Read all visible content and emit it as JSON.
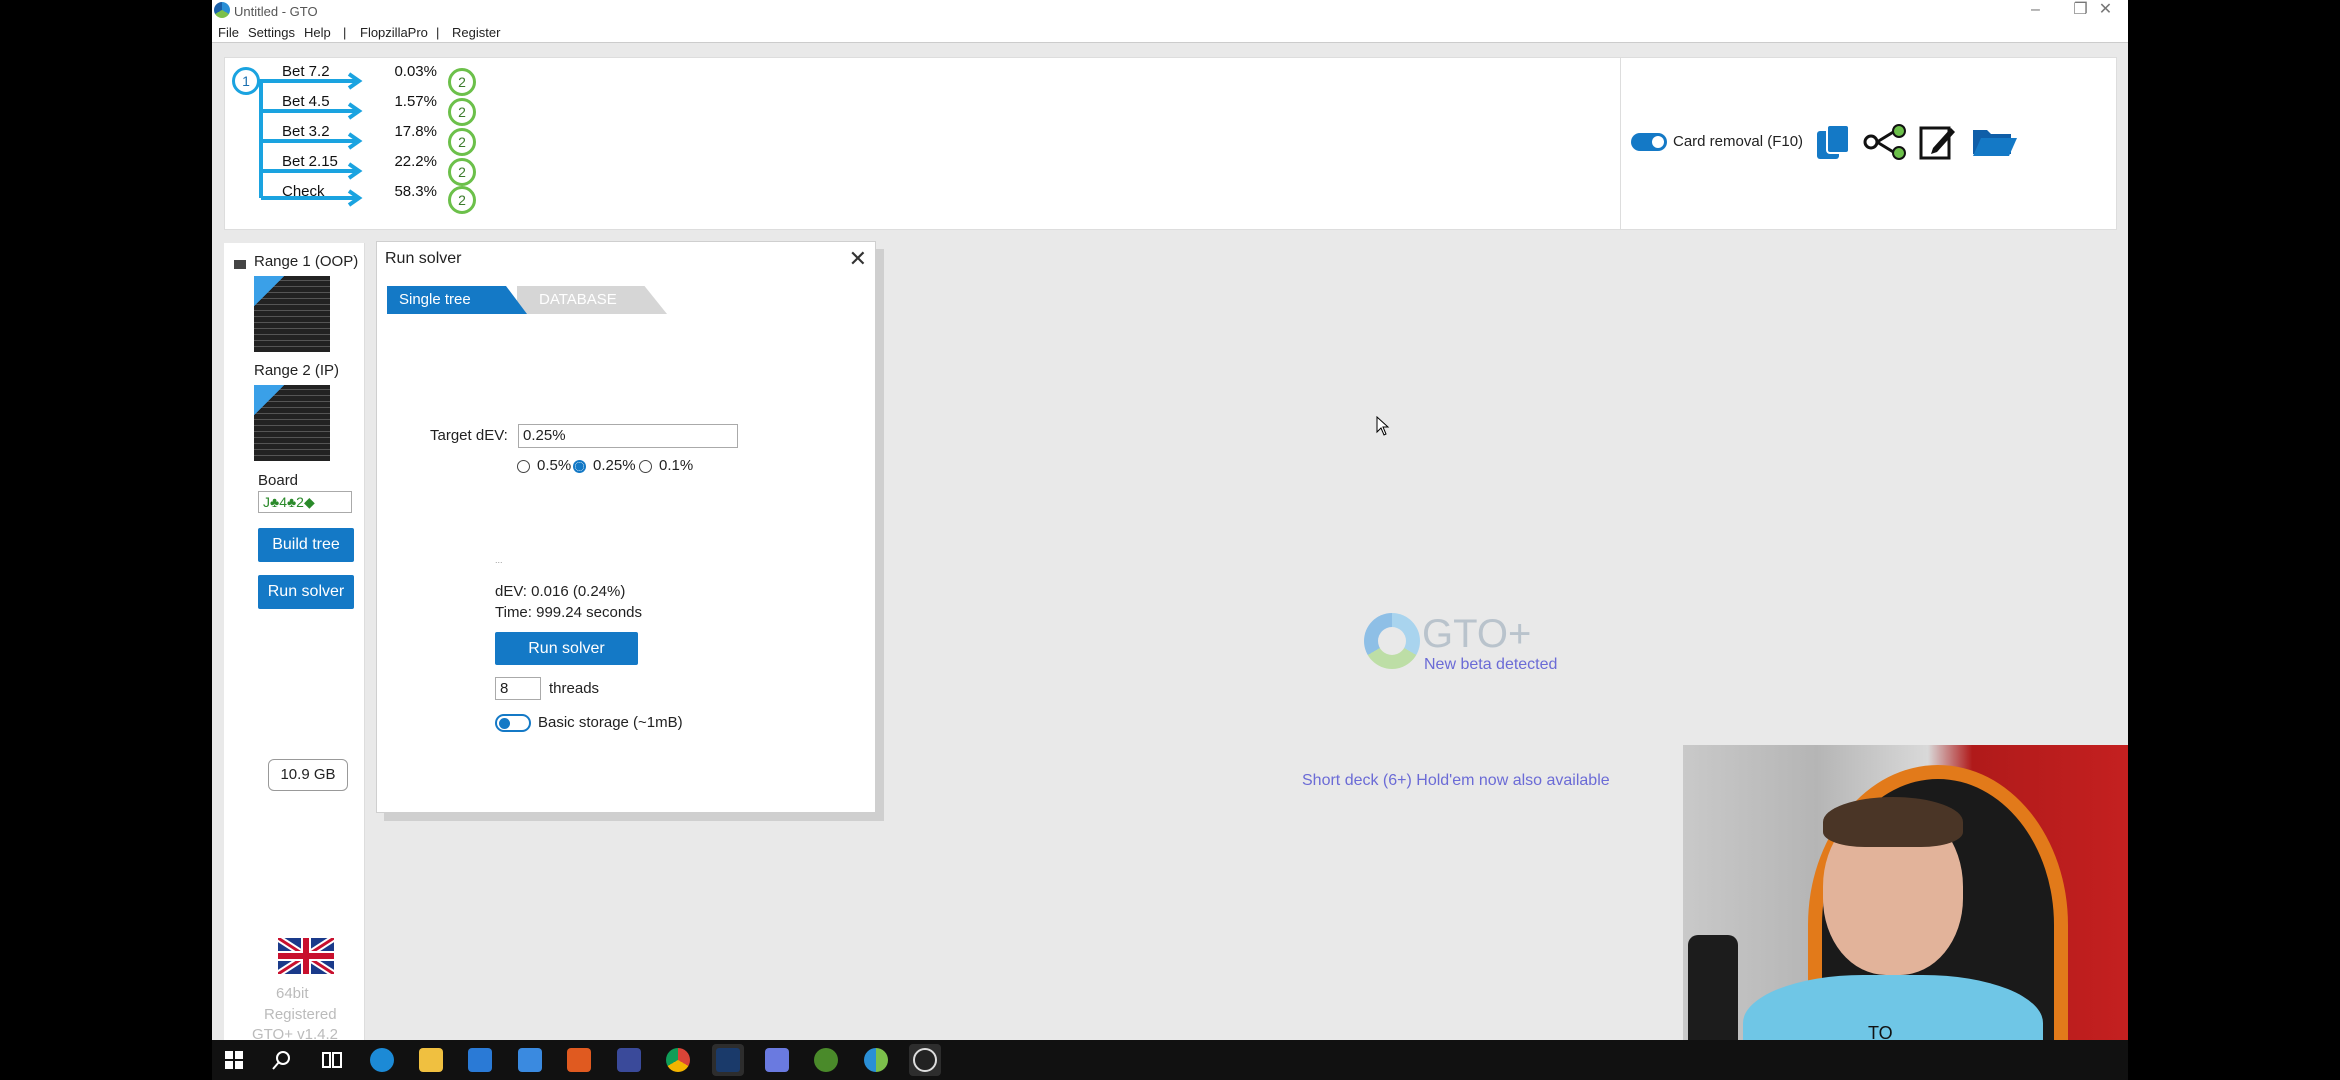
{
  "window": {
    "title": "Untitled - GTO"
  },
  "menu": {
    "file": "File",
    "settings": "Settings",
    "help": "Help",
    "sep1": "|",
    "flopzilla": "FlopzillaPro",
    "sep2": "|",
    "register": "Register"
  },
  "tree": {
    "root": "1",
    "actions": [
      {
        "label": "Bet 7.2",
        "pct": "0.03%",
        "child": "2"
      },
      {
        "label": "Bet 4.5",
        "pct": "1.57%",
        "child": "2"
      },
      {
        "label": "Bet 3.2",
        "pct": "17.8%",
        "child": "2"
      },
      {
        "label": "Bet 2.15",
        "pct": "22.2%",
        "child": "2"
      },
      {
        "label": "Check",
        "pct": "58.3%",
        "child": "2"
      }
    ]
  },
  "options": {
    "card_removal": "Card removal (F10)"
  },
  "sidebar": {
    "range1": "Range 1 (OOP)",
    "range2": "Range 2 (IP)",
    "board_label": "Board",
    "board_value": "J♣4♣2◆",
    "build_tree": "Build tree",
    "run_solver": "Run solver",
    "memory": "10.9 GB",
    "bits": "64bit",
    "registered": "Registered",
    "version": "GTO+ v1.4.2"
  },
  "dialog": {
    "title": "Run solver",
    "close": "✕",
    "tab_single": "Single tree",
    "tab_database": "DATABASE",
    "target_label": "Target dEV:",
    "target_value": "0.25%",
    "radio": [
      "0.5%",
      "0.25%",
      "0.1%"
    ],
    "ellipsis": "...",
    "dev": "dEV: 0.016 (0.24%)",
    "time": "Time: 999.24 seconds",
    "run_button": "Run solver",
    "threads_value": "8",
    "threads_label": "threads",
    "storage": "Basic storage (~1mB)"
  },
  "center": {
    "brand": "GTO+",
    "beta": "New beta detected",
    "shortdeck": "Short deck (6+) Hold'em now also available"
  },
  "webcam": {
    "shirt_text": "TO"
  },
  "colors": {
    "accent": "#1479c6",
    "tree_blue": "#1aa3e0",
    "tree_green": "#6cc04a",
    "link": "#6b6bd6"
  }
}
